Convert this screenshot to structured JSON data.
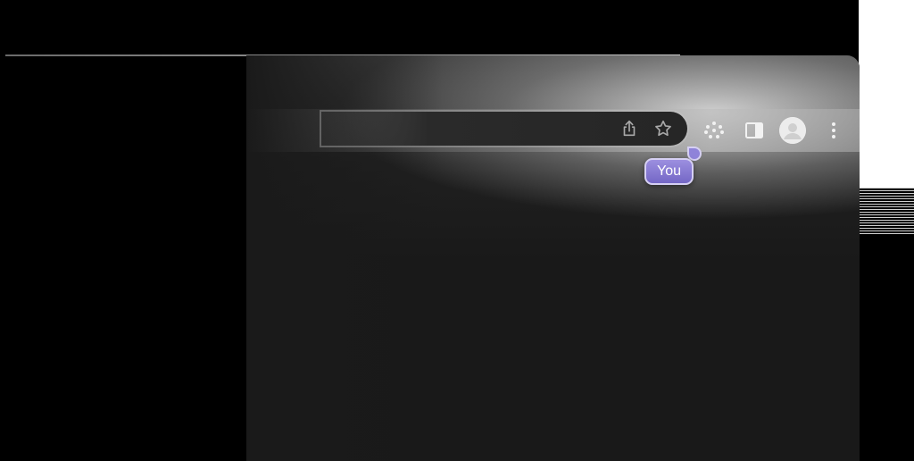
{
  "colors": {
    "background": "#000000",
    "window": "#191919",
    "omnibox": "#262626",
    "cursor_tag": "#7e71cc",
    "cursor_border": "#d6d0f3",
    "icon": "#bdbdbd"
  },
  "icons": {
    "share": "share-icon",
    "bookmark": "star-icon",
    "extensions": "dotted-grid-icon",
    "side_panel": "side-panel-icon",
    "profile": "avatar-icon",
    "menu": "three-dots-vertical-icon"
  },
  "cursor": {
    "label": "You"
  }
}
